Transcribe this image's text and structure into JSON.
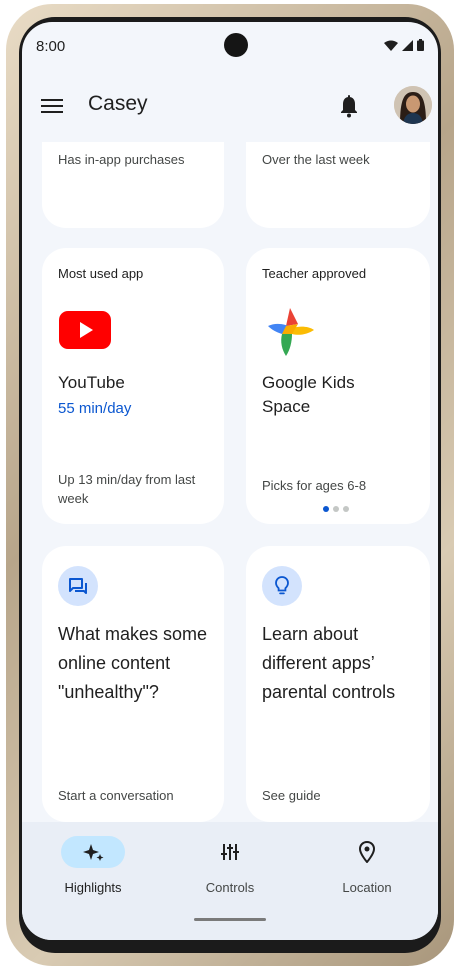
{
  "status_bar": {
    "time": "8:00",
    "icons": [
      "wifi-icon",
      "signal-icon",
      "battery-icon"
    ]
  },
  "app_bar": {
    "title": "Casey",
    "menu_icon": "menu-icon",
    "notification_icon": "bell-icon",
    "avatar_icon": "avatar"
  },
  "top_cards": {
    "left_text": "Has in-app purchases",
    "right_text": "Over the last week"
  },
  "most_used": {
    "label": "Most used app",
    "icon": "youtube-icon",
    "app_name": "YouTube",
    "usage": "55 min/day",
    "footer": "Up 13 min/day from last week"
  },
  "teacher_approved": {
    "label": "Teacher approved",
    "icon": "google-kids-space-icon",
    "app_name": "Google Kids Space",
    "footer": "Picks for ages 6-8",
    "pager": {
      "count": 3,
      "active": 1
    }
  },
  "conversation_card": {
    "icon": "chat-icon",
    "question": "What makes some online content \"unhealthy\"?",
    "footer": "Start a conversation"
  },
  "guide_card": {
    "icon": "lightbulb-icon",
    "question": "Learn about different apps’ parental controls",
    "footer": "See guide"
  },
  "bottom_nav": {
    "items": [
      {
        "label": "Highlights",
        "icon": "sparkle-icon",
        "active": true
      },
      {
        "label": "Controls",
        "icon": "sliders-icon",
        "active": false
      },
      {
        "label": "Location",
        "icon": "location-pin-icon",
        "active": false
      }
    ]
  },
  "colors": {
    "accent": "#0b57d0",
    "screen_background": "#f3f6fb",
    "card_background": "#ffffff",
    "nav_background": "#e9eef6",
    "active_pill": "#c2e7ff",
    "icon_circle": "#d3e3fd",
    "youtube_red": "#ff0000"
  }
}
